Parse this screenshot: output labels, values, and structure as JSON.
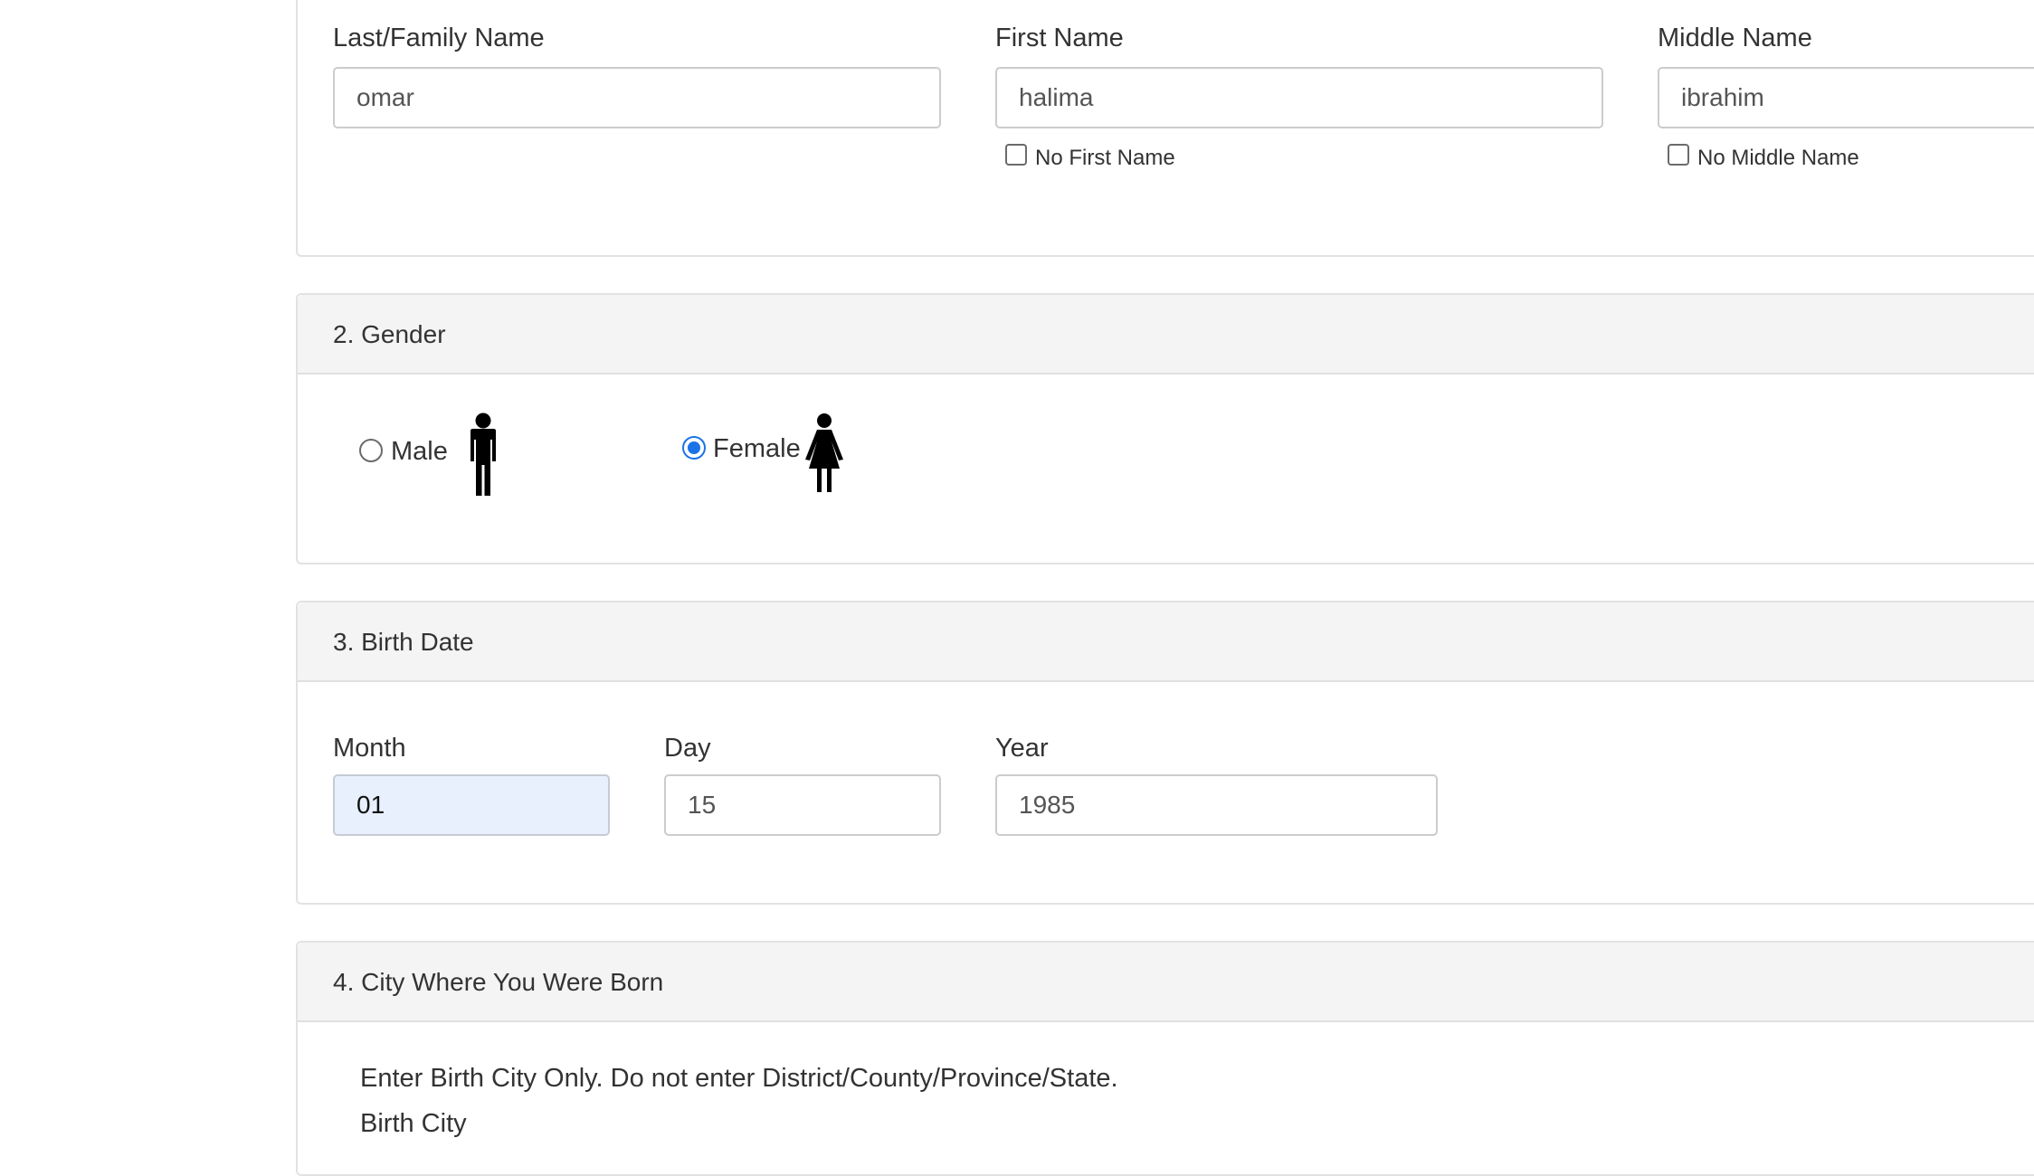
{
  "name_section": {
    "last_name": {
      "label": "Last/Family Name",
      "value": "omar"
    },
    "first_name": {
      "label": "First Name",
      "value": "halima",
      "none_label": "No First Name"
    },
    "middle_name": {
      "label": "Middle Name",
      "value": "ibrahim",
      "none_label": "No Middle Name"
    }
  },
  "gender_section": {
    "title": "2. Gender",
    "options": [
      {
        "label": "Male",
        "icon": "male-person-icon",
        "selected": false
      },
      {
        "label": "Female",
        "icon": "female-person-icon",
        "selected": true
      }
    ]
  },
  "birth_date_section": {
    "title": "3. Birth Date",
    "month": {
      "label": "Month",
      "value": "01"
    },
    "day": {
      "label": "Day",
      "value": "15"
    },
    "year": {
      "label": "Year",
      "value": "1985"
    }
  },
  "birth_city_section": {
    "title": "4. City Where You Were Born",
    "instruction": "Enter Birth City Only. Do not enter District/County/Province/State.",
    "city_label": "Birth City"
  },
  "colors": {
    "accent": "#1a73e8",
    "focused_field_bg": "#e8f0fe",
    "panel_header_bg": "#f4f4f4"
  }
}
